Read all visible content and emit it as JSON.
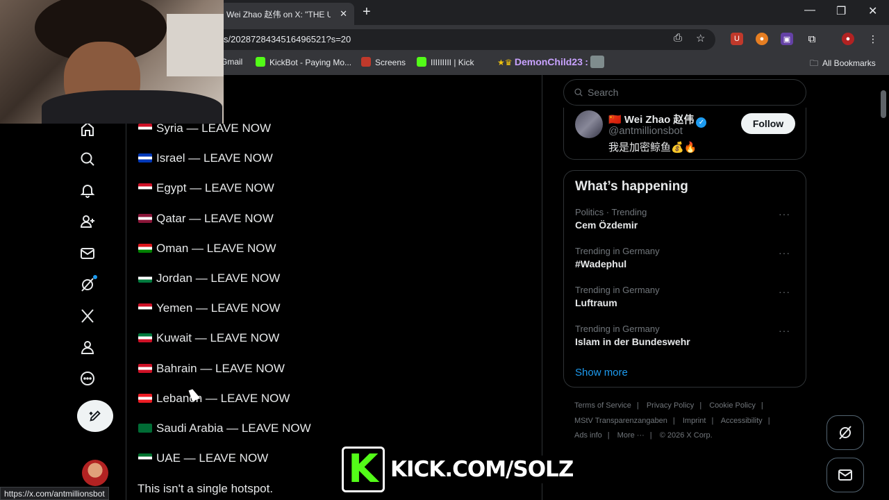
{
  "browser": {
    "tab_title": "Wei Zhao 赵伟 on X: \"THE U",
    "tab_close": "✕",
    "new_tab": "+",
    "url": "s/2028728434516496521?s=20",
    "bookmarks": [
      {
        "label": "Gmail",
        "color": "#ea4335"
      },
      {
        "label": "KickBot - Paying Mo...",
        "color": "#53fc18"
      },
      {
        "label": "Screens",
        "color": "#c0392b"
      },
      {
        "label": "IIIIIIIII | Kick",
        "color": "#53fc18"
      }
    ],
    "bookmark_user": "DemonChild23",
    "bookmark_user_suffix": ":",
    "all_bookmarks": "All Bookmarks",
    "status_url": "https://x.com/antmillionsbot"
  },
  "sidebar_nav": [
    "home-icon",
    "search-icon",
    "bell-icon",
    "add-person-icon",
    "mail-icon",
    "grok-icon",
    "x-logo-icon",
    "profile-icon",
    "more-icon"
  ],
  "post": {
    "countries": [
      {
        "text": "Syria — LEAVE NOW",
        "flag": [
          "#ce1126",
          "#ffffff",
          "#000000"
        ]
      },
      {
        "text": "Israel — LEAVE NOW",
        "flag": [
          "#0038b8",
          "#ffffff",
          "#0038b8"
        ]
      },
      {
        "text": "Egypt — LEAVE NOW",
        "flag": [
          "#ce1126",
          "#ffffff",
          "#000000"
        ]
      },
      {
        "text": "Qatar — LEAVE NOW",
        "flag": [
          "#8a1538",
          "#ffffff",
          "#8a1538"
        ]
      },
      {
        "text": "Oman — LEAVE NOW",
        "flag": [
          "#db161b",
          "#ffffff",
          "#008000"
        ]
      },
      {
        "text": "Jordan — LEAVE NOW",
        "flag": [
          "#000000",
          "#ffffff",
          "#007a3d"
        ]
      },
      {
        "text": "Yemen — LEAVE NOW",
        "flag": [
          "#ce1126",
          "#ffffff",
          "#000000"
        ]
      },
      {
        "text": "Kuwait — LEAVE NOW",
        "flag": [
          "#007a3d",
          "#ffffff",
          "#ce1126"
        ]
      },
      {
        "text": "Bahrain — LEAVE NOW",
        "flag": [
          "#ce1126",
          "#ffffff",
          "#ce1126"
        ]
      },
      {
        "text": "Lebanon — LEAVE NOW",
        "flag": [
          "#ed1c24",
          "#ffffff",
          "#ed1c24"
        ]
      },
      {
        "text": "Saudi Arabia — LEAVE NOW",
        "flag": [
          "#006c35",
          "#006c35",
          "#006c35"
        ]
      },
      {
        "text": "UAE — LEAVE NOW",
        "flag": [
          "#00732f",
          "#ffffff",
          "#000000"
        ]
      }
    ],
    "closing_line": "This isn't a single hotspot."
  },
  "right": {
    "search_placeholder": "Search",
    "profile": {
      "name": "🇨🇳 Wei Zhao 赵伟",
      "handle": "@antmillionsbot",
      "bio": "我是加密鲸鱼💰🔥",
      "follow_label": "Follow"
    },
    "happening": {
      "title": "What’s happening",
      "trends": [
        {
          "context": "Politics · Trending",
          "name": "Cem Özdemir"
        },
        {
          "context": "Trending in Germany",
          "name": "#Wadephul"
        },
        {
          "context": "Trending in Germany",
          "name": "Luftraum"
        },
        {
          "context": "Trending in Germany",
          "name": "Islam in der Bundeswehr"
        }
      ],
      "more_glyph": "···",
      "show_more": "Show more"
    },
    "footer": {
      "row1": [
        "Terms of Service",
        "Privacy Policy",
        "Cookie Policy"
      ],
      "row2": [
        "MStV Transparenzangaben",
        "Imprint",
        "Accessibility"
      ],
      "row3": [
        "Ads info",
        "More ···",
        "© 2026 X Corp."
      ]
    }
  },
  "overlay": {
    "kick_letter": "K",
    "kick_text": "KICK.COM/SOLZ"
  }
}
